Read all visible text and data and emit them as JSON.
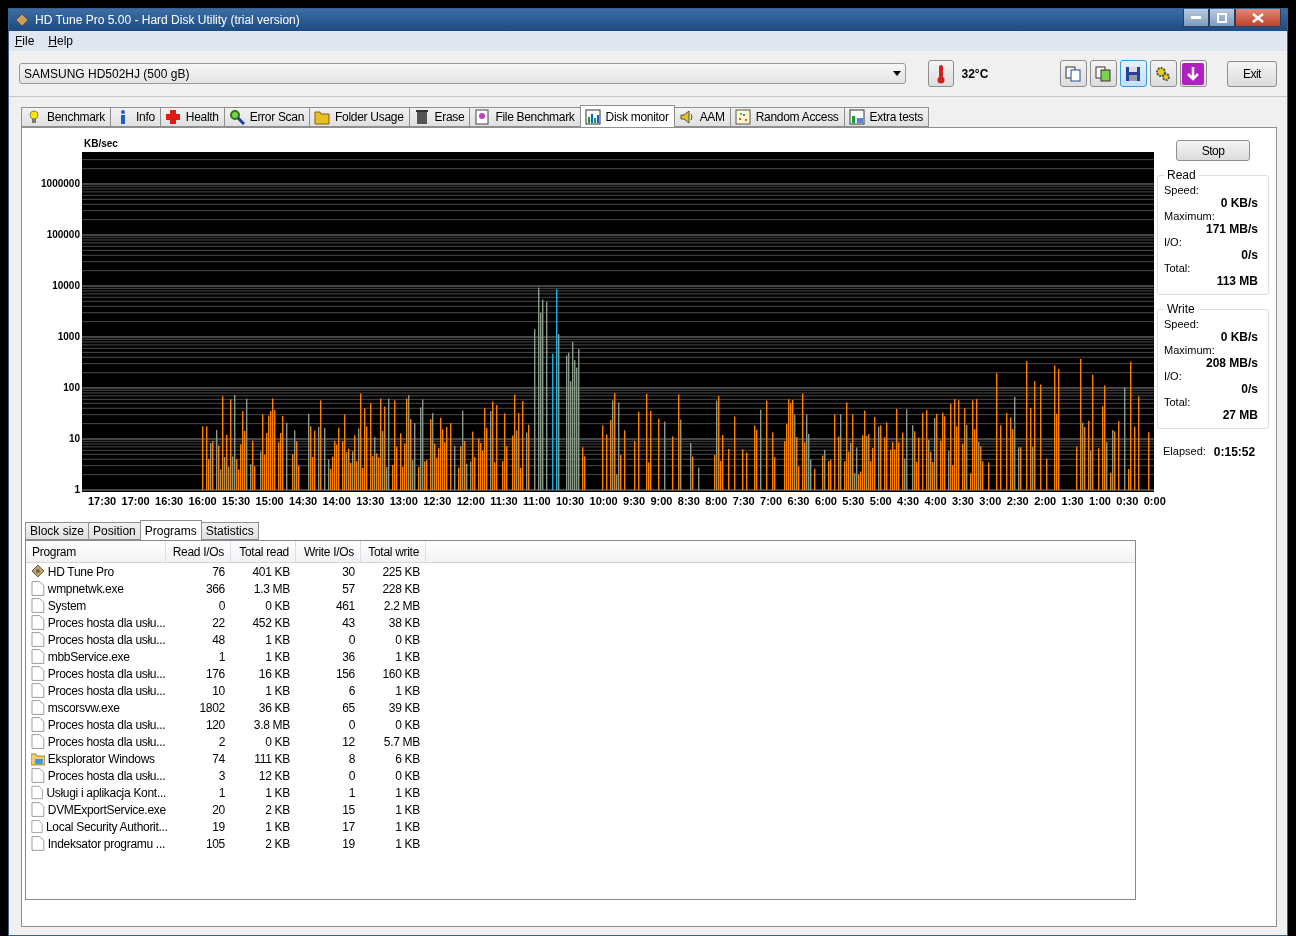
{
  "window": {
    "title": "HD Tune Pro 5.00 - Hard Disk Utility (trial version)"
  },
  "menu": [
    {
      "label": "File"
    },
    {
      "label": "Help"
    }
  ],
  "drive": {
    "value": "SAMSUNG HD502HJ (500 gB)"
  },
  "temperature": "32°C",
  "toolbar": [
    {
      "kind": "copy",
      "selected": false
    },
    {
      "kind": "compare",
      "selected": false
    },
    {
      "kind": "save",
      "selected": true
    },
    {
      "kind": "options",
      "selected": false
    },
    {
      "kind": "download",
      "selected": false
    }
  ],
  "exit_button": "Exit",
  "tabs": [
    {
      "label": "Benchmark",
      "kind": "bulb",
      "selected": false
    },
    {
      "label": "Info",
      "kind": "info",
      "selected": false
    },
    {
      "label": "Health",
      "kind": "cross",
      "selected": false
    },
    {
      "label": "Error Scan",
      "kind": "magnifier",
      "selected": false
    },
    {
      "label": "Folder Usage",
      "kind": "folder",
      "selected": false
    },
    {
      "label": "Erase",
      "kind": "bin",
      "selected": false
    },
    {
      "label": "File Benchmark",
      "kind": "filebench",
      "selected": false
    },
    {
      "label": "Disk monitor",
      "kind": "graph",
      "selected": true
    },
    {
      "label": "AAM",
      "kind": "speaker",
      "selected": false
    },
    {
      "label": "Random Access",
      "kind": "scatter",
      "selected": false
    },
    {
      "label": "Extra tests",
      "kind": "grid",
      "selected": false
    }
  ],
  "chart": {
    "unit": "KB/sec",
    "y_labels": [
      "1000000",
      "100000",
      "10000",
      "1000",
      "100",
      "10",
      "1"
    ],
    "x_labels": [
      "17:30",
      "17:00",
      "16:30",
      "16:00",
      "15:30",
      "15:00",
      "14:30",
      "14:00",
      "13:30",
      "13:00",
      "12:30",
      "12:00",
      "11:30",
      "11:00",
      "10:30",
      "10:00",
      "9:30",
      "9:00",
      "8:30",
      "8:00",
      "7:30",
      "7:00",
      "6:30",
      "6:00",
      "5:30",
      "5:00",
      "4:30",
      "4:00",
      "3:30",
      "3:00",
      "2:30",
      "2:00",
      "1:30",
      "1:00",
      "0:30",
      "0:00"
    ]
  },
  "stop_button": "Stop",
  "read": {
    "title": "Read",
    "speed_label": "Speed:",
    "speed": "0 KB/s",
    "maximum_label": "Maximum:",
    "maximum": "171 MB/s",
    "io_label": "I/O:",
    "io": "0/s",
    "total_label": "Total:",
    "total": "113 MB"
  },
  "write": {
    "title": "Write",
    "speed_label": "Speed:",
    "speed": "0 KB/s",
    "maximum_label": "Maximum:",
    "maximum": "208 MB/s",
    "io_label": "I/O:",
    "io": "0/s",
    "total_label": "Total:",
    "total": "27 MB"
  },
  "elapsed": {
    "label": "Elapsed:",
    "value": "0:15:52"
  },
  "sub_tabs": [
    {
      "label": "Block size",
      "selected": false
    },
    {
      "label": "Position",
      "selected": false
    },
    {
      "label": "Programs",
      "selected": true
    },
    {
      "label": "Statistics",
      "selected": false
    }
  ],
  "table": {
    "columns": [
      "Program",
      "Read I/Os",
      "Total read",
      "Write I/Os",
      "Total write"
    ],
    "rows": [
      {
        "kind": "disk",
        "cells": [
          "HD Tune Pro",
          "76",
          "401 KB",
          "30",
          "225 KB"
        ]
      },
      {
        "kind": "file",
        "cells": [
          "wmpnetwk.exe",
          "366",
          "1.3 MB",
          "57",
          "228 KB"
        ]
      },
      {
        "kind": "file",
        "cells": [
          "System",
          "0",
          "0 KB",
          "461",
          "2.2 MB"
        ]
      },
      {
        "kind": "file",
        "cells": [
          "Proces hosta dla usłu...",
          "22",
          "452 KB",
          "43",
          "38 KB"
        ]
      },
      {
        "kind": "file",
        "cells": [
          "Proces hosta dla usłu...",
          "48",
          "1 KB",
          "0",
          "0 KB"
        ]
      },
      {
        "kind": "file",
        "cells": [
          "mbbService.exe",
          "1",
          "1 KB",
          "36",
          "1 KB"
        ]
      },
      {
        "kind": "file",
        "cells": [
          "Proces hosta dla usłu...",
          "176",
          "16 KB",
          "156",
          "160 KB"
        ]
      },
      {
        "kind": "file",
        "cells": [
          "Proces hosta dla usłu...",
          "10",
          "1 KB",
          "6",
          "1 KB"
        ]
      },
      {
        "kind": "file",
        "cells": [
          "mscorsvw.exe",
          "1802",
          "36 KB",
          "65",
          "39 KB"
        ]
      },
      {
        "kind": "file",
        "cells": [
          "Proces hosta dla usłu...",
          "120",
          "3.8 MB",
          "0",
          "0 KB"
        ]
      },
      {
        "kind": "file",
        "cells": [
          "Proces hosta dla usłu...",
          "2",
          "0 KB",
          "12",
          "5.7 MB"
        ]
      },
      {
        "kind": "explorer",
        "cells": [
          "Eksplorator Windows",
          "74",
          "111 KB",
          "8",
          "6 KB"
        ]
      },
      {
        "kind": "file",
        "cells": [
          "Proces hosta dla usłu...",
          "3",
          "12 KB",
          "0",
          "0 KB"
        ]
      },
      {
        "kind": "file",
        "cells": [
          "Usługi i aplikacja Kont...",
          "1",
          "1 KB",
          "1",
          "1 KB"
        ]
      },
      {
        "kind": "file",
        "cells": [
          "DVMExportService.exe",
          "20",
          "2 KB",
          "15",
          "1 KB"
        ]
      },
      {
        "kind": "file",
        "cells": [
          "Local Security Authorit...",
          "19",
          "1 KB",
          "17",
          "1 KB"
        ]
      },
      {
        "kind": "file",
        "cells": [
          "Indeksator programu ...",
          "105",
          "2 KB",
          "19",
          "1 KB"
        ]
      }
    ]
  }
}
